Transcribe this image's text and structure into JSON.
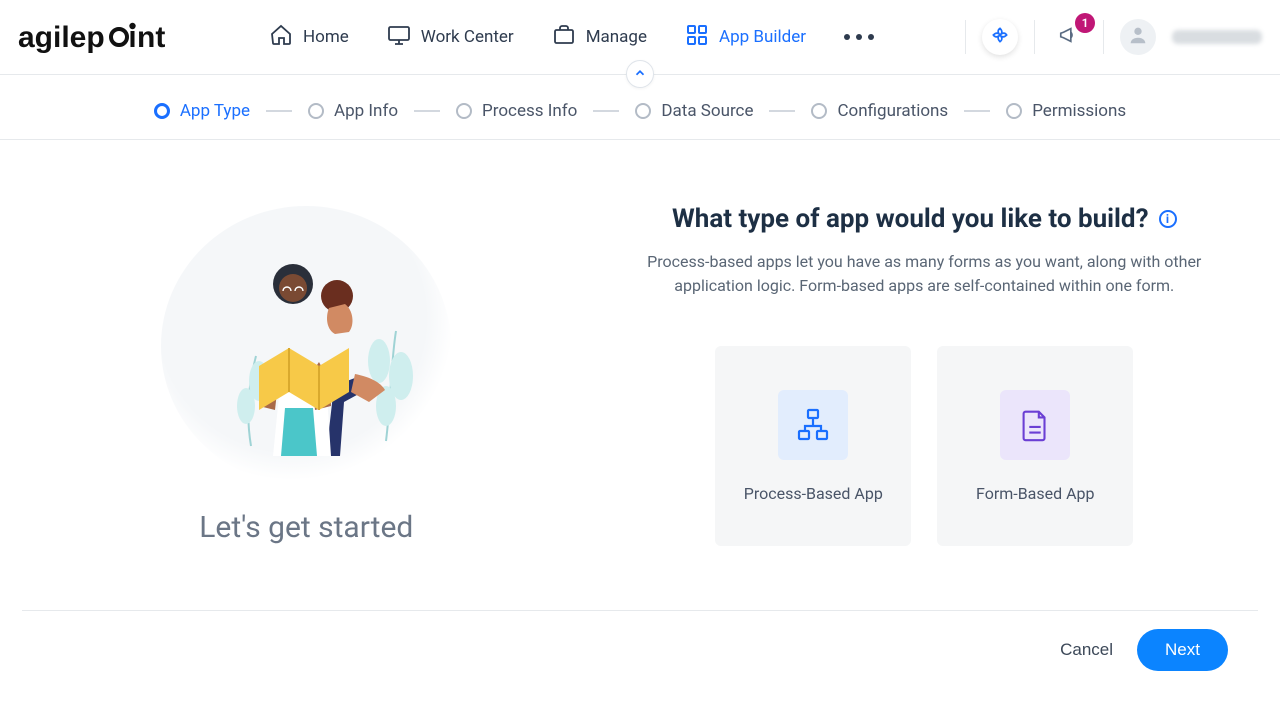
{
  "logo_text": "agilepoint",
  "nav": {
    "home": "Home",
    "work_center": "Work Center",
    "manage": "Manage",
    "app_builder": "App Builder"
  },
  "notifications_count": "1",
  "stepper": {
    "app_type": "App Type",
    "app_info": "App Info",
    "process_info": "Process Info",
    "data_source": "Data Source",
    "configurations": "Configurations",
    "permissions": "Permissions"
  },
  "hero_title": "Let's get started",
  "main": {
    "title": "What type of app would you like to build?",
    "description": "Process-based apps let you have as many forms as you want, along with other application logic. Form-based apps are self-contained within one form."
  },
  "cards": {
    "process": "Process-Based App",
    "form": "Form-Based App"
  },
  "footer": {
    "cancel": "Cancel",
    "next": "Next"
  }
}
